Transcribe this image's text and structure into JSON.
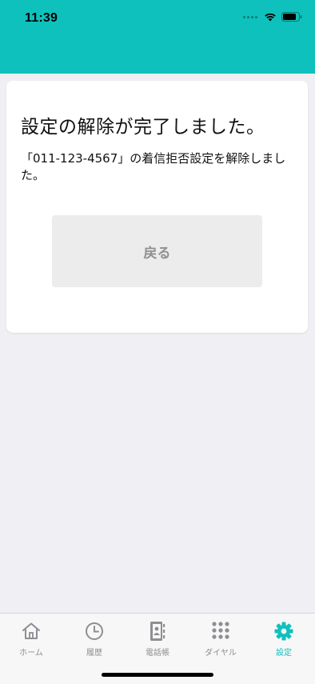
{
  "status_bar": {
    "time": "11:39",
    "icons": [
      "signal-icon",
      "wifi-icon",
      "battery-icon"
    ]
  },
  "colors": {
    "accent": "#0fc1bc",
    "background": "#efeff4",
    "button_bg": "#ececec",
    "inactive_tab": "#8e8e93"
  },
  "card": {
    "title": "設定の解除が完了しました。",
    "message": "「011-123-4567」の着信拒否設定を解除しました。",
    "back_button": "戻る"
  },
  "tabbar": {
    "items": [
      {
        "label": "ホーム",
        "icon": "home-icon",
        "active": false
      },
      {
        "label": "履歴",
        "icon": "clock-icon",
        "active": false
      },
      {
        "label": "電話帳",
        "icon": "contacts-book-icon",
        "active": false
      },
      {
        "label": "ダイヤル",
        "icon": "dialpad-icon",
        "active": false
      },
      {
        "label": "設定",
        "icon": "gear-icon",
        "active": true
      }
    ]
  }
}
